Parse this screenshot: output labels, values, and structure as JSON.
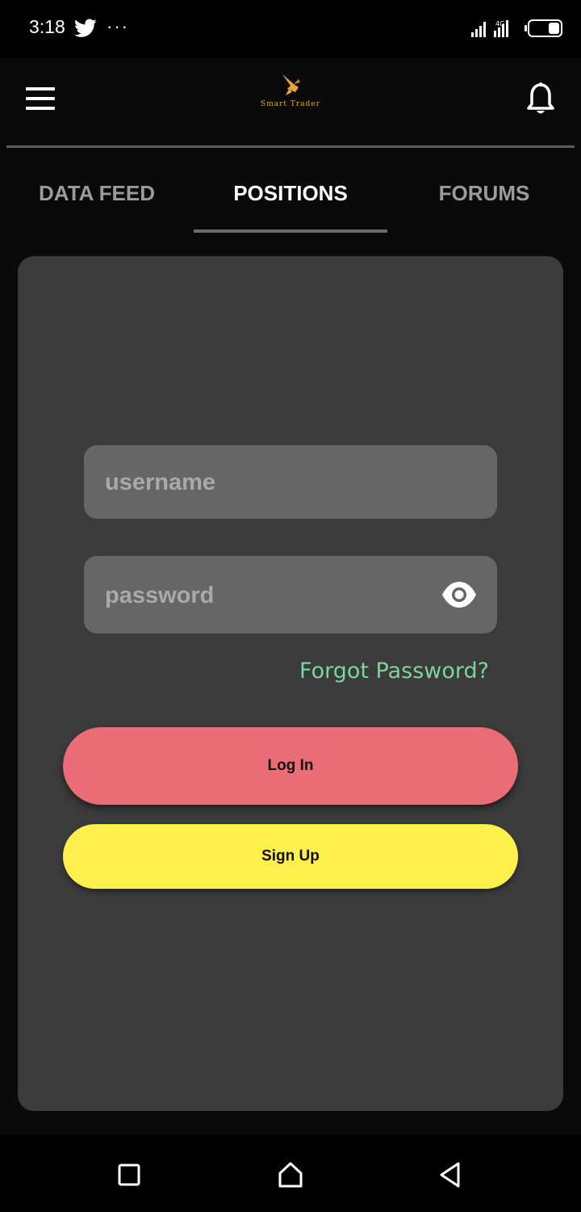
{
  "status_bar": {
    "time": "3:18",
    "overflow": "···",
    "icons": [
      "twitter-icon",
      "signal-icon",
      "battery-icon"
    ]
  },
  "header": {
    "brand_name": "Smart Trader",
    "icons": [
      "menu-icon",
      "brand-logo",
      "bell-icon"
    ],
    "brand_color": "#e9a43a"
  },
  "tabs": [
    {
      "label": "DATA FEED",
      "active": false
    },
    {
      "label": "POSITIONS",
      "active": true
    },
    {
      "label": "FORUMS",
      "active": false
    }
  ],
  "login_form": {
    "username_placeholder": "username",
    "password_placeholder": "password",
    "forgot_password": "Forgot Password?",
    "login_label": "Log In",
    "signup_label": "Sign Up",
    "colors": {
      "login_button": "#ea6c76",
      "signup_button": "#fdf04d",
      "forgot_link": "#7dd3a0",
      "card": "#3b3b3b",
      "field": "#666666"
    }
  },
  "nav_bar": {
    "icons": [
      "recents-icon",
      "home-icon",
      "back-icon"
    ]
  }
}
